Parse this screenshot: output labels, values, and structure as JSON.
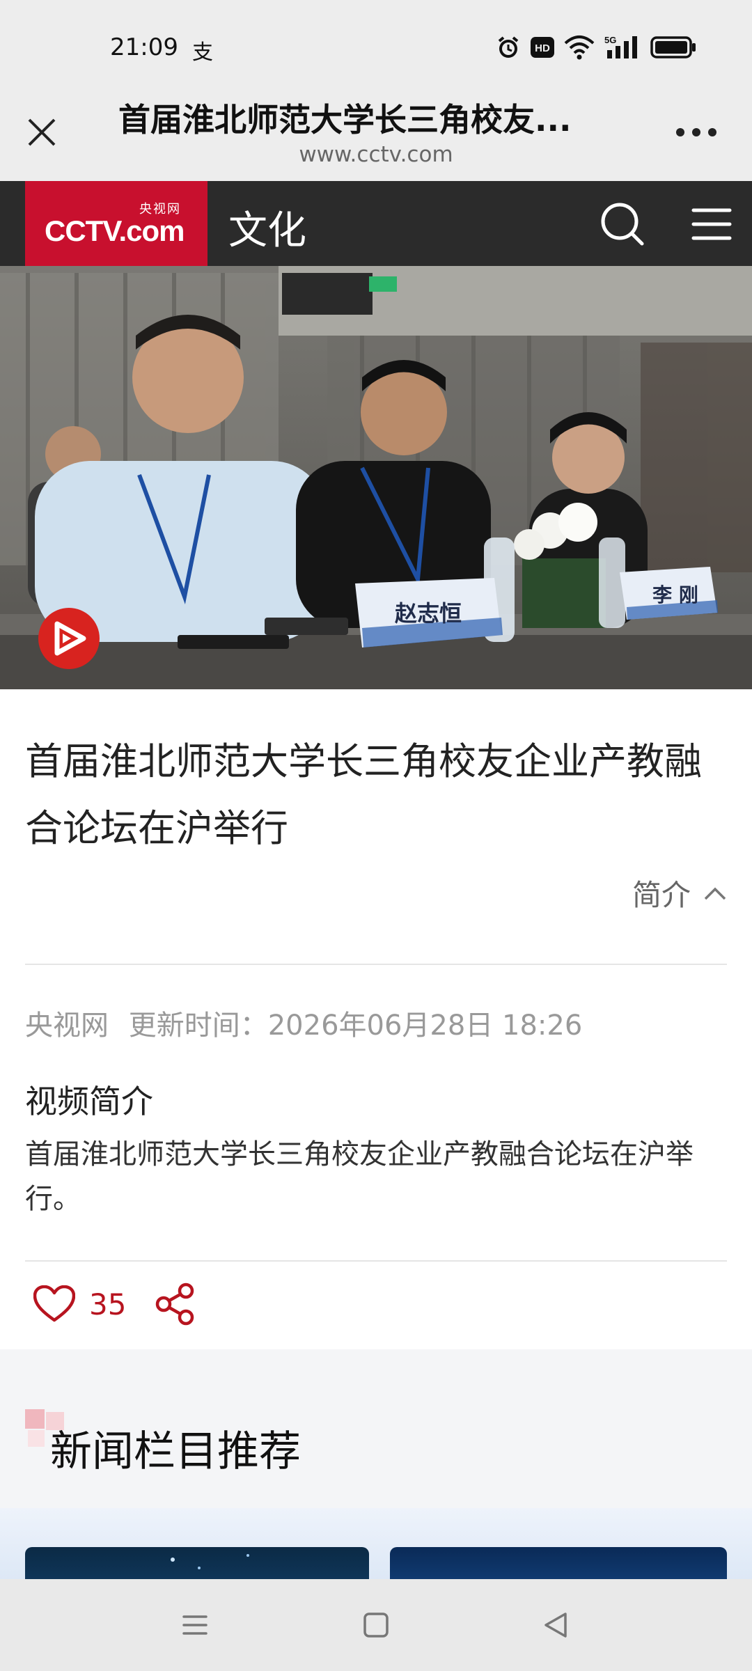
{
  "status_bar": {
    "time": "21:09",
    "indicator": "支",
    "icons": [
      "alarm-icon",
      "hd-icon",
      "wifi-icon",
      "5g-signal-icon",
      "battery-icon"
    ],
    "network_label": "5G",
    "hd_label": "HD"
  },
  "title_bar": {
    "title": "首届淮北师范大学长三角校友...",
    "url": "www.cctv.com"
  },
  "site_header": {
    "logo_small": "央视网",
    "logo_main": "CCTV.com",
    "section": "文化",
    "brand_color": "#c8102e"
  },
  "hero": {
    "name_card_1": "赵志恒",
    "name_card_2": "李 刚"
  },
  "article": {
    "title": "首届淮北师范大学长三角校友企业产教融合论坛在沪举行",
    "intro_toggle": "简介",
    "source": "央视网",
    "updated_label": "更新时间：",
    "updated_time": "2026年06月28日 18:26",
    "desc_title": "视频简介",
    "desc_body": "首届淮北师范大学长三角校友企业产教融合论坛在沪举行。",
    "like_count": "35",
    "accent_color": "#b7141f"
  },
  "recommend": {
    "title": "新闻栏目推荐"
  }
}
